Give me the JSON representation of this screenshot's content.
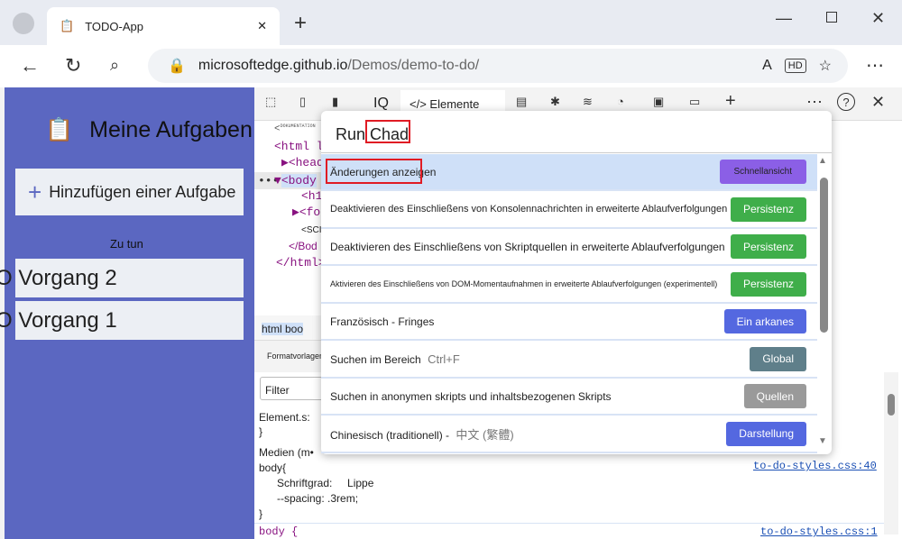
{
  "browser": {
    "tab_title": "TODO-App",
    "url_host": "microsoftedge.github.io",
    "url_path": "/Demos/demo-to-do/"
  },
  "app": {
    "title": "Meine Aufgaben",
    "add_label": "Hinzufügen einer Aufgabe",
    "section": "Zu tun",
    "tasks": [
      "Vorgang 2",
      "Vorgang 1"
    ]
  },
  "devtools": {
    "tabs": {
      "iq": "IQ",
      "elements": "Elemente"
    },
    "dom": [
      "<",
      "DOKUMENTATION",
      "<html l",
      "<head",
      "<body",
      "<h1",
      "<for",
      "<SCI",
      "</Bod",
      "</html>"
    ],
    "breadcrumb": "html boo",
    "styles_tab": "Formatvorlagen",
    "filter_placeholder": "Filter",
    "styles": {
      "element": "Element.s:",
      "close": "}",
      "media": "Medien (m•",
      "body_open": "body{",
      "prop1": "Schriftgrad:",
      "val1": "Lippe",
      "prop2": "--spacing: .3rem;",
      "link1": "to-do-styles.css:40",
      "body2": "body {",
      "link2": "to-do-styles.css:1"
    }
  },
  "palette": {
    "input": "Run Chad",
    "items": [
      {
        "label": "Änderungen anzeigen",
        "badge": "Schnellansicht",
        "color": "#8b5fe6",
        "hint": ""
      },
      {
        "label": "Deaktivieren des Einschließens von Konsolennachrichten in erweiterte Ablaufverfolgungen",
        "badge": "Persistenz",
        "color": "#3fae4a",
        "hint": ""
      },
      {
        "label": "Deaktivieren des Einschließens von Skriptquellen in erweiterte Ablaufverfolgungen",
        "badge": "Persistenz",
        "color": "#3fae4a",
        "hint": ""
      },
      {
        "label": "Aktivieren des Einschließens von DOM-Momentaufnahmen in erweiterte Ablaufverfolgungen (experimentell)",
        "badge": "Persistenz",
        "color": "#3fae4a",
        "hint": ""
      },
      {
        "label": "Französisch - Fringes",
        "badge": "Ein arkanes",
        "color": "#5468e0",
        "hint": ""
      },
      {
        "label": "Suchen im Bereich",
        "badge": "Global",
        "color": "#5f7f8a",
        "hint": "Ctrl+F"
      },
      {
        "label": "Suchen in anonymen skripts und inhaltsbezogenen Skripts",
        "badge": "Quellen",
        "color": "#9a9a9a",
        "hint": ""
      },
      {
        "label": "Chinesisch (traditionell) -",
        "badge": "Darstellung",
        "color": "#5468e0",
        "hint": "中文 (繁體)"
      }
    ]
  }
}
